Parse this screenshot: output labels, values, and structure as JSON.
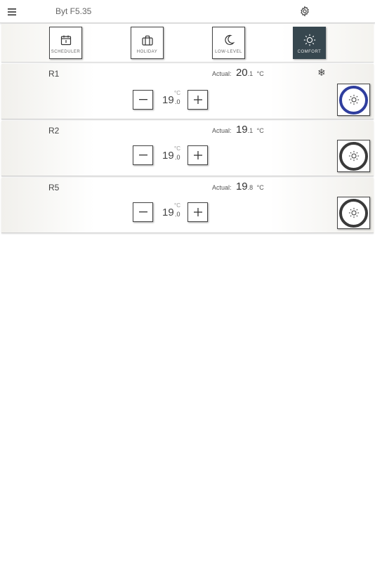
{
  "header": {
    "menu_icon": "hamburger-menu-icon",
    "title": "Byt F5.35",
    "settings_icon": "gear-icon"
  },
  "modes": [
    {
      "id": "scheduler",
      "label": "SCHEDULER",
      "icon": "calendar-icon",
      "active": false
    },
    {
      "id": "holiday",
      "label": "HOLIDAY",
      "icon": "suitcase-icon",
      "active": false
    },
    {
      "id": "low-level",
      "label": "LOW-LEVEL",
      "icon": "moon-icon",
      "active": false
    },
    {
      "id": "comfort",
      "label": "COMFORT",
      "icon": "sun-icon",
      "active": true
    }
  ],
  "rooms": [
    {
      "name": "R1",
      "actual_label": "Actual:",
      "actual_int": "20",
      "actual_dec": ".1",
      "actual_unit": "°C",
      "setpoint_int": "19",
      "setpoint_dec": ".0",
      "setpoint_unit": "°C",
      "cooling_icon": "snowflake-icon",
      "cooling_symbol": "❄",
      "mode_active": true
    },
    {
      "name": "R2",
      "actual_label": "Actual:",
      "actual_int": "19",
      "actual_dec": ".1",
      "actual_unit": "°C",
      "setpoint_int": "19",
      "setpoint_dec": ".0",
      "setpoint_unit": "°C",
      "mode_active": false
    },
    {
      "name": "R5",
      "actual_label": "Actual:",
      "actual_int": "19",
      "actual_dec": ".8",
      "actual_unit": "°C",
      "setpoint_int": "19",
      "setpoint_dec": ".0",
      "setpoint_unit": "°C",
      "mode_active": false
    }
  ],
  "colors": {
    "active_mode_bg": "#37474f",
    "active_ring": "#2f3e9e",
    "inactive_ring": "#3a3a3a"
  }
}
